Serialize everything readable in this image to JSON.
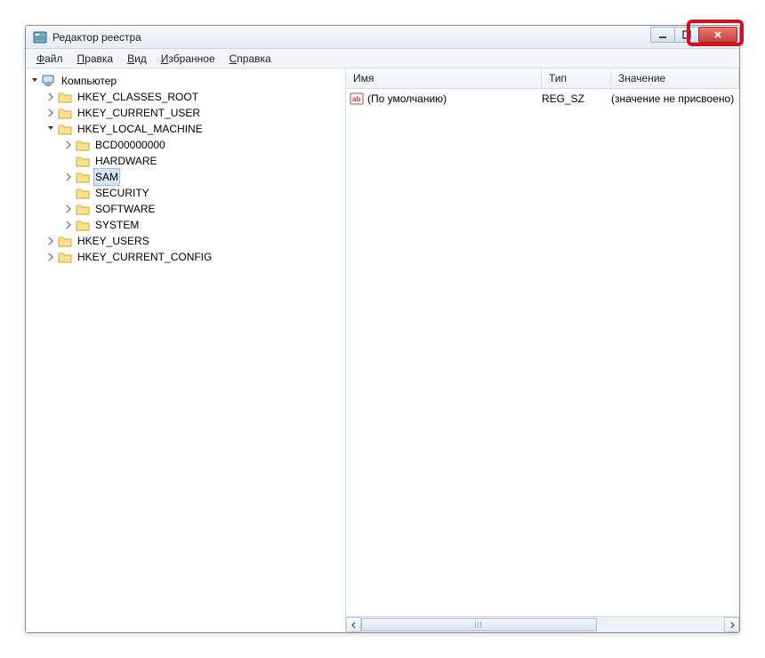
{
  "window": {
    "title": "Редактор реестра"
  },
  "menu": {
    "file": {
      "u": "Ф",
      "rest": "айл"
    },
    "edit": {
      "u": "П",
      "rest": "равка"
    },
    "view": {
      "u": "В",
      "rest": "ид"
    },
    "fav": {
      "u": "И",
      "rest": "збранное"
    },
    "help": {
      "u": "С",
      "rest": "правка"
    }
  },
  "tree": {
    "root": "Компьютер",
    "hives": {
      "hkcr": "HKEY_CLASSES_ROOT",
      "hkcu": "HKEY_CURRENT_USER",
      "hklm": "HKEY_LOCAL_MACHINE",
      "hku": "HKEY_USERS",
      "hkcc": "HKEY_CURRENT_CONFIG"
    },
    "hklm_children": {
      "bcd": "BCD00000000",
      "hardware": "HARDWARE",
      "sam": "SAM",
      "security": "SECURITY",
      "software": "SOFTWARE",
      "system": "SYSTEM"
    },
    "selected": "SAM"
  },
  "list": {
    "headers": {
      "name": "Имя",
      "type": "Тип",
      "value": "Значение"
    },
    "rows": [
      {
        "name": "(По умолчанию)",
        "type": "REG_SZ",
        "value": "(значение не присвоено)"
      }
    ]
  }
}
